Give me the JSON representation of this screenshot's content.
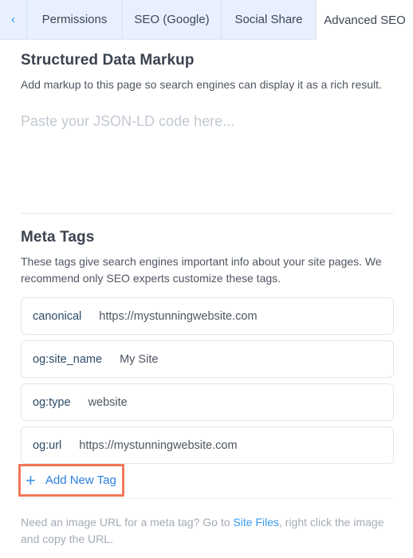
{
  "tabs": {
    "back_icon": "‹",
    "items": [
      {
        "label": "Permissions",
        "active": false
      },
      {
        "label": "SEO (Google)",
        "active": false
      },
      {
        "label": "Social Share",
        "active": false
      },
      {
        "label": "Advanced SEO",
        "active": true
      }
    ]
  },
  "structured_data": {
    "title": "Structured Data Markup",
    "description": "Add markup to this page so search engines can display it as a rich result.",
    "placeholder": "Paste your JSON-LD code here...",
    "value": ""
  },
  "meta_tags": {
    "title": "Meta Tags",
    "description": "These tags give search engines important info about your site pages. We recommend only SEO experts customize these tags.",
    "tags": [
      {
        "name": "canonical",
        "value": "https://mystunningwebsite.com"
      },
      {
        "name": "og:site_name",
        "value": "My Site"
      },
      {
        "name": "og:type",
        "value": "website"
      },
      {
        "name": "og:url",
        "value": "https://mystunningwebsite.com"
      }
    ],
    "add_label": "Add New Tag",
    "add_icon": "+",
    "highlight_color": "#f37759"
  },
  "footer": {
    "text_before": "Need an image URL for a meta tag? Go to ",
    "link_label": "Site Files",
    "text_after": ", right click the image and copy the URL."
  },
  "colors": {
    "accent": "#3899ec",
    "tab_inactive_bg": "#e8f0fd"
  }
}
